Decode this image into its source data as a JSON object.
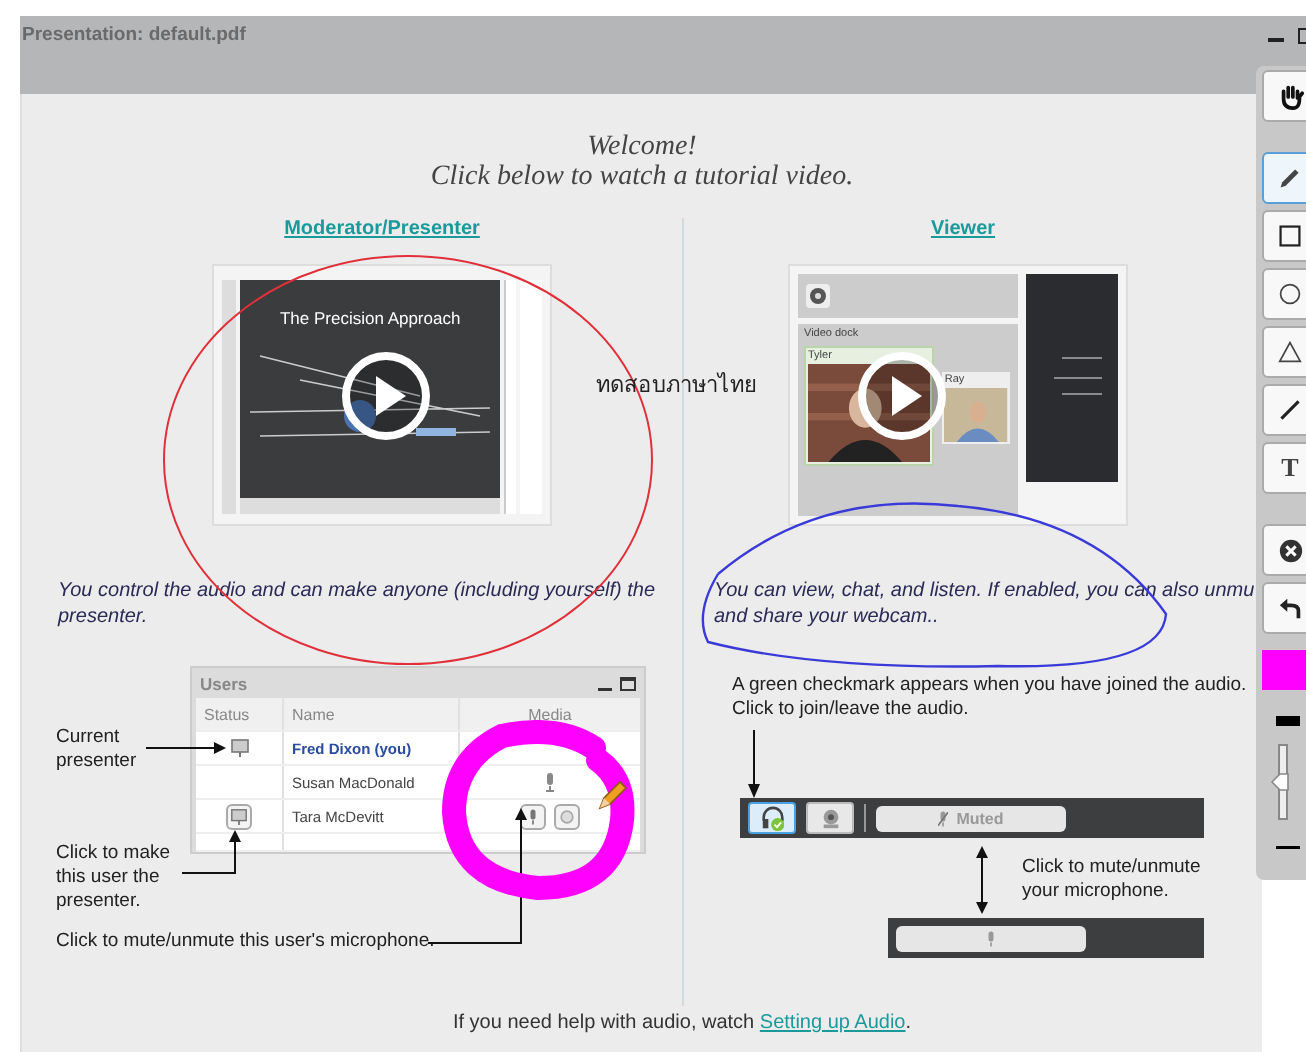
{
  "window": {
    "title": "Presentation: default.pdf"
  },
  "slide": {
    "heading": [
      "Welcome!",
      "Click below to watch a tutorial video."
    ],
    "left": {
      "link": "Moderator/Presenter",
      "video_title": "The Precision Approach",
      "caption": "You control the audio and can make anyone (including yourself) the presenter."
    },
    "right": {
      "link": "Viewer",
      "video_labels": [
        "Video dock",
        "Tyler",
        "Ray"
      ],
      "caption": [
        "You can view, chat, and listen.  If enabled, you can also unmu",
        "and share your webcam.."
      ]
    },
    "users_panel": {
      "title": "Users",
      "columns": [
        "Status",
        "Name",
        "Media"
      ],
      "rows": [
        {
          "kind": "presenter",
          "name": "Fred Dixon (you)"
        },
        {
          "kind": "talking",
          "name": "Susan MacDonald"
        },
        {
          "kind": "controls",
          "name": "Tara McDevitt"
        }
      ]
    },
    "user_callouts": [
      "Current presenter",
      "Click to make this user the presenter.",
      "Click to mute/unmute this user's microphone."
    ],
    "audio": {
      "callout": "A green checkmark appears when you have joined the audio.  Click to join/leave the audio.",
      "joined": true,
      "muted_label": "Muted",
      "mic_callout": "Click to mute/unmute your microphone."
    },
    "footer": {
      "text": "If you need help with audio, watch ",
      "link": "Setting up Audio",
      "end": "."
    },
    "annotation_text": "ทดสอบภาษาไทย"
  },
  "toolbar": {
    "tools": [
      {
        "kind": "hand",
        "selected": false
      },
      {
        "kind": "pencil",
        "selected": true
      },
      {
        "kind": "rectangle",
        "selected": false
      },
      {
        "kind": "ellipse",
        "selected": false
      },
      {
        "kind": "triangle",
        "selected": false
      },
      {
        "kind": "line",
        "selected": false
      },
      {
        "kind": "text",
        "label": "T",
        "selected": false
      }
    ],
    "actions": [
      {
        "kind": "clear"
      },
      {
        "kind": "undo"
      }
    ],
    "color": "#ff00ff",
    "thickness": {
      "level": 0.5
    }
  }
}
